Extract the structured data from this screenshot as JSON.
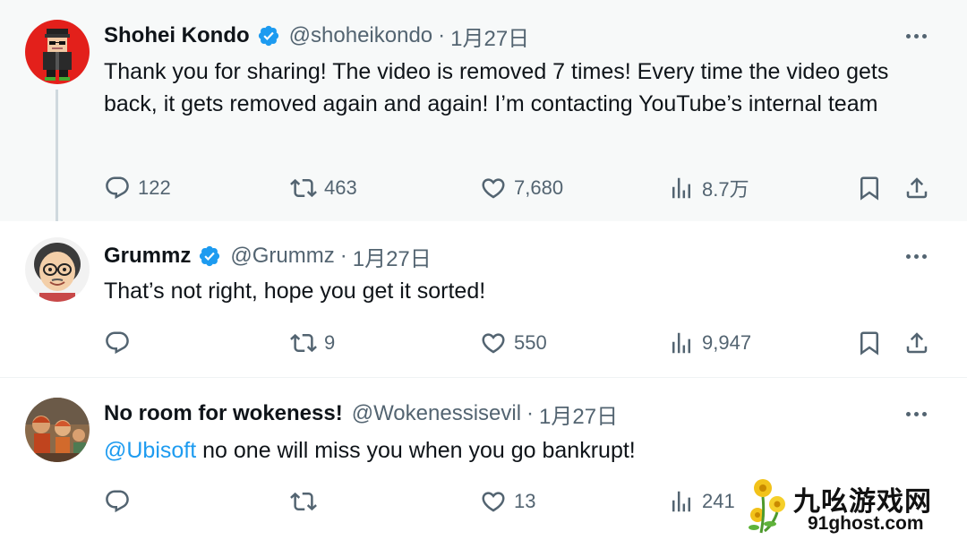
{
  "tweets": [
    {
      "display_name": "Shohei Kondo",
      "verified": true,
      "handle": "@shoheikondo",
      "separator": "·",
      "date": "1月27日",
      "body": "Thank you for sharing! The video is removed 7 times! Every time the video gets back, it gets removed again and again! I’m contacting YouTube’s internal team",
      "replies": "122",
      "retweets": "463",
      "likes": "7,680",
      "views": "8.7万"
    },
    {
      "display_name": "Grummz",
      "verified": true,
      "handle": "@Grummz",
      "separator": "·",
      "date": "1月27日",
      "body": "That’s not right, hope you get it sorted!",
      "replies": "",
      "retweets": "9",
      "likes": "550",
      "views": "9,947"
    },
    {
      "display_name": "No room for wokeness!",
      "verified": false,
      "handle": "@Wokenessisevil",
      "separator": "·",
      "date": "1月27日",
      "body_mention": "@Ubisoft",
      "body": " no one will miss you when you go bankrupt!",
      "replies": "",
      "retweets": "",
      "likes": "13",
      "views": "241"
    }
  ],
  "icons": {
    "reply": "reply-icon",
    "retweet": "retweet-icon",
    "like": "heart-icon",
    "views": "views-chart-icon",
    "bookmark": "bookmark-icon",
    "share": "share-icon",
    "more": "more-dots-icon",
    "verified": "verified-badge-icon"
  },
  "colors": {
    "text": "#0f1419",
    "muted": "#536471",
    "accent": "#1d9bf0",
    "highlight_bg": "#f7f9f9"
  },
  "watermark": {
    "brand": "九吆游戏网",
    "url": "91ghost.com"
  }
}
